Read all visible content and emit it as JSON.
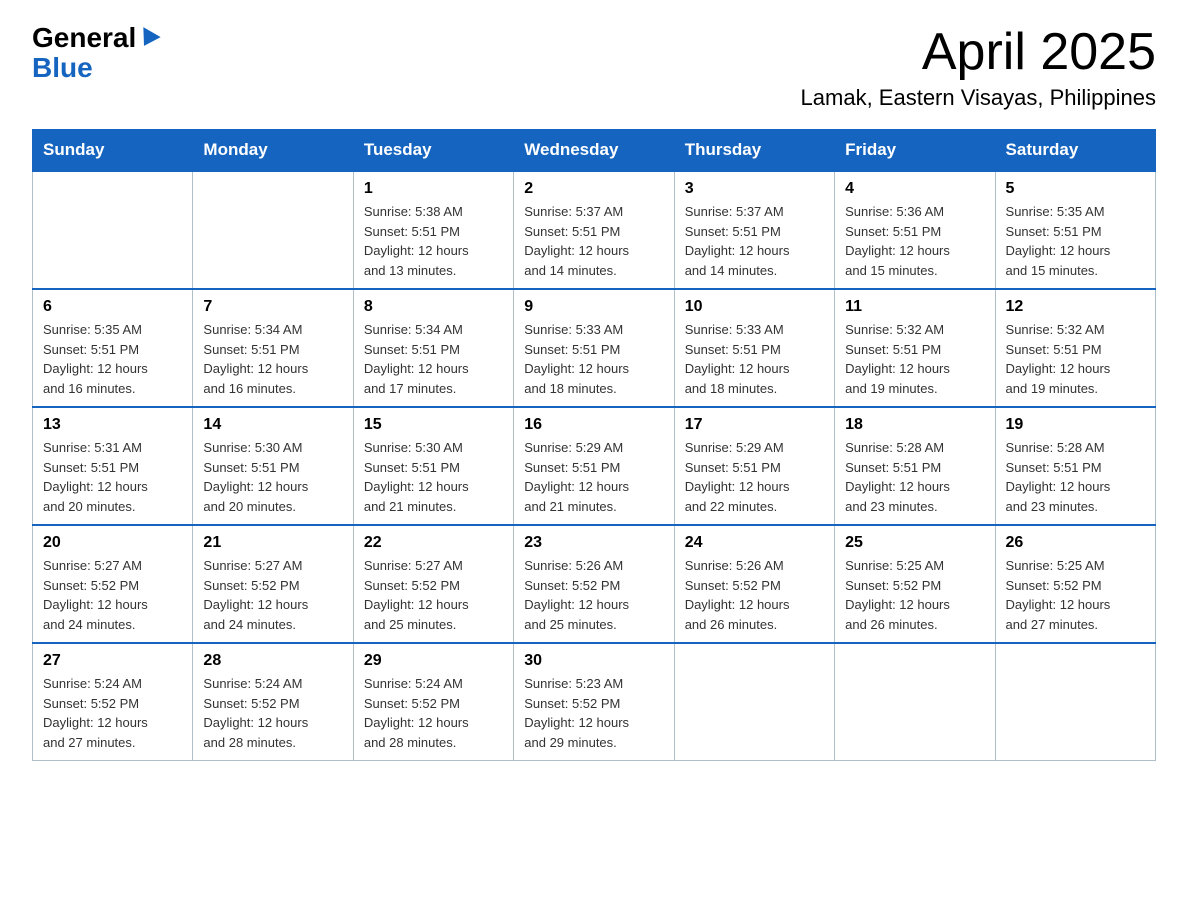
{
  "header": {
    "logo_general": "General",
    "logo_blue": "Blue",
    "month": "April 2025",
    "location": "Lamak, Eastern Visayas, Philippines"
  },
  "days_of_week": [
    "Sunday",
    "Monday",
    "Tuesday",
    "Wednesday",
    "Thursday",
    "Friday",
    "Saturday"
  ],
  "weeks": [
    [
      {
        "day": "",
        "info": ""
      },
      {
        "day": "",
        "info": ""
      },
      {
        "day": "1",
        "info": "Sunrise: 5:38 AM\nSunset: 5:51 PM\nDaylight: 12 hours\nand 13 minutes."
      },
      {
        "day": "2",
        "info": "Sunrise: 5:37 AM\nSunset: 5:51 PM\nDaylight: 12 hours\nand 14 minutes."
      },
      {
        "day": "3",
        "info": "Sunrise: 5:37 AM\nSunset: 5:51 PM\nDaylight: 12 hours\nand 14 minutes."
      },
      {
        "day": "4",
        "info": "Sunrise: 5:36 AM\nSunset: 5:51 PM\nDaylight: 12 hours\nand 15 minutes."
      },
      {
        "day": "5",
        "info": "Sunrise: 5:35 AM\nSunset: 5:51 PM\nDaylight: 12 hours\nand 15 minutes."
      }
    ],
    [
      {
        "day": "6",
        "info": "Sunrise: 5:35 AM\nSunset: 5:51 PM\nDaylight: 12 hours\nand 16 minutes."
      },
      {
        "day": "7",
        "info": "Sunrise: 5:34 AM\nSunset: 5:51 PM\nDaylight: 12 hours\nand 16 minutes."
      },
      {
        "day": "8",
        "info": "Sunrise: 5:34 AM\nSunset: 5:51 PM\nDaylight: 12 hours\nand 17 minutes."
      },
      {
        "day": "9",
        "info": "Sunrise: 5:33 AM\nSunset: 5:51 PM\nDaylight: 12 hours\nand 18 minutes."
      },
      {
        "day": "10",
        "info": "Sunrise: 5:33 AM\nSunset: 5:51 PM\nDaylight: 12 hours\nand 18 minutes."
      },
      {
        "day": "11",
        "info": "Sunrise: 5:32 AM\nSunset: 5:51 PM\nDaylight: 12 hours\nand 19 minutes."
      },
      {
        "day": "12",
        "info": "Sunrise: 5:32 AM\nSunset: 5:51 PM\nDaylight: 12 hours\nand 19 minutes."
      }
    ],
    [
      {
        "day": "13",
        "info": "Sunrise: 5:31 AM\nSunset: 5:51 PM\nDaylight: 12 hours\nand 20 minutes."
      },
      {
        "day": "14",
        "info": "Sunrise: 5:30 AM\nSunset: 5:51 PM\nDaylight: 12 hours\nand 20 minutes."
      },
      {
        "day": "15",
        "info": "Sunrise: 5:30 AM\nSunset: 5:51 PM\nDaylight: 12 hours\nand 21 minutes."
      },
      {
        "day": "16",
        "info": "Sunrise: 5:29 AM\nSunset: 5:51 PM\nDaylight: 12 hours\nand 21 minutes."
      },
      {
        "day": "17",
        "info": "Sunrise: 5:29 AM\nSunset: 5:51 PM\nDaylight: 12 hours\nand 22 minutes."
      },
      {
        "day": "18",
        "info": "Sunrise: 5:28 AM\nSunset: 5:51 PM\nDaylight: 12 hours\nand 23 minutes."
      },
      {
        "day": "19",
        "info": "Sunrise: 5:28 AM\nSunset: 5:51 PM\nDaylight: 12 hours\nand 23 minutes."
      }
    ],
    [
      {
        "day": "20",
        "info": "Sunrise: 5:27 AM\nSunset: 5:52 PM\nDaylight: 12 hours\nand 24 minutes."
      },
      {
        "day": "21",
        "info": "Sunrise: 5:27 AM\nSunset: 5:52 PM\nDaylight: 12 hours\nand 24 minutes."
      },
      {
        "day": "22",
        "info": "Sunrise: 5:27 AM\nSunset: 5:52 PM\nDaylight: 12 hours\nand 25 minutes."
      },
      {
        "day": "23",
        "info": "Sunrise: 5:26 AM\nSunset: 5:52 PM\nDaylight: 12 hours\nand 25 minutes."
      },
      {
        "day": "24",
        "info": "Sunrise: 5:26 AM\nSunset: 5:52 PM\nDaylight: 12 hours\nand 26 minutes."
      },
      {
        "day": "25",
        "info": "Sunrise: 5:25 AM\nSunset: 5:52 PM\nDaylight: 12 hours\nand 26 minutes."
      },
      {
        "day": "26",
        "info": "Sunrise: 5:25 AM\nSunset: 5:52 PM\nDaylight: 12 hours\nand 27 minutes."
      }
    ],
    [
      {
        "day": "27",
        "info": "Sunrise: 5:24 AM\nSunset: 5:52 PM\nDaylight: 12 hours\nand 27 minutes."
      },
      {
        "day": "28",
        "info": "Sunrise: 5:24 AM\nSunset: 5:52 PM\nDaylight: 12 hours\nand 28 minutes."
      },
      {
        "day": "29",
        "info": "Sunrise: 5:24 AM\nSunset: 5:52 PM\nDaylight: 12 hours\nand 28 minutes."
      },
      {
        "day": "30",
        "info": "Sunrise: 5:23 AM\nSunset: 5:52 PM\nDaylight: 12 hours\nand 29 minutes."
      },
      {
        "day": "",
        "info": ""
      },
      {
        "day": "",
        "info": ""
      },
      {
        "day": "",
        "info": ""
      }
    ]
  ]
}
